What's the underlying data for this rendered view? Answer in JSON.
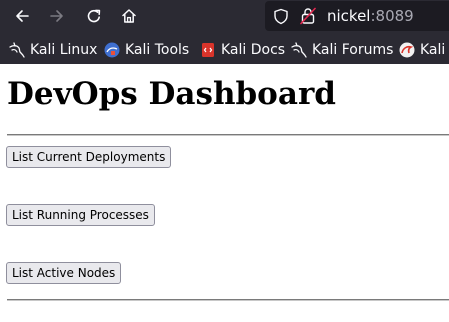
{
  "browser": {
    "url": {
      "host": "nickel",
      "port": ":8089"
    },
    "bookmarks": [
      {
        "label": "Kali Linux",
        "icon": "kali-dragon-icon"
      },
      {
        "label": "Kali Tools",
        "icon": "kali-tools-icon"
      },
      {
        "label": "Kali Docs",
        "icon": "kali-docs-icon"
      },
      {
        "label": "Kali Forums",
        "icon": "kali-dragon-icon"
      },
      {
        "label": "Kali",
        "icon": "kali-nethunter-icon"
      }
    ],
    "colors": {
      "toolbar": "#2b2a33",
      "urlbar": "#1c1b22",
      "text": "#fbfbfe",
      "muted": "#a9a9b3"
    }
  },
  "page": {
    "title": "DevOps Dashboard",
    "buttons": [
      {
        "label": "List Current Deployments"
      },
      {
        "label": "List Running Processes"
      },
      {
        "label": "List Active Nodes"
      }
    ]
  }
}
